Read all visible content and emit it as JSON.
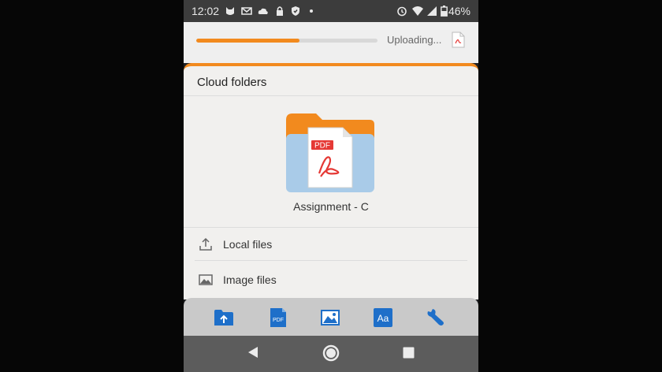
{
  "status_bar": {
    "time": "12:02",
    "battery": "46%",
    "icons": [
      "cat-icon",
      "gmail-icon",
      "cloud-icon",
      "lock-icon",
      "shield-icon",
      "dot-icon",
      "alarm-icon",
      "wifi-icon",
      "signal-icon",
      "battery-icon"
    ]
  },
  "upload": {
    "status_text": "Uploading...",
    "progress": 0.57,
    "colors": {
      "progress": "#f28a1e",
      "track": "#d8d8d8"
    }
  },
  "cloud_folders": {
    "title": "Cloud folders",
    "file_name": "Assignment - C",
    "file_badge": "PDF",
    "colors": {
      "accent": "#f28a1e",
      "folder_back": "#f28a1e",
      "folder_front": "#a9cbe8",
      "pdf_red": "#e53935"
    }
  },
  "rows": [
    {
      "label": "Local files",
      "icon": "upload-icon"
    },
    {
      "label": "Image files",
      "icon": "image-icon"
    }
  ],
  "toolbar": {
    "items": [
      {
        "name": "folder-upload-icon",
        "text": ""
      },
      {
        "name": "pdf-icon",
        "text": "PDF"
      },
      {
        "name": "image-icon",
        "text": ""
      },
      {
        "name": "font-icon",
        "text": "Aa"
      },
      {
        "name": "wrench-icon",
        "text": ""
      }
    ],
    "color": "#1e6fc9"
  },
  "nav": {
    "buttons": [
      "back-button",
      "home-button",
      "recents-button"
    ]
  }
}
